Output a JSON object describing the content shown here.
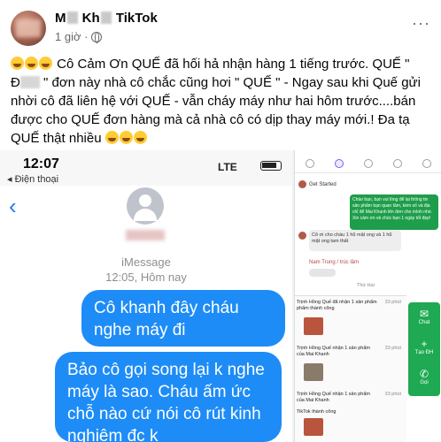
{
  "post": {
    "author_visible": "M",
    "author_visible_2": "Kh",
    "author_suffix": "TikTok",
    "time": "1 giờ ·",
    "more": "···",
    "text_line1": "Cô Cảm Ơn QUẾ đã hối hả nhận hàng 1 tiếng trước. QUẾ \"",
    "text_line2a": "Đ",
    "text_line2b": "\" đơn này nhà cô chắc cũng hơi \" QUẾ \" - Ngay sau khi Quế gửi",
    "text_line3": "nhời cô đã liên hệ với QUẾ - vẫn cháy máy như hai hôm trước....bán",
    "text_line4": "được cho QUẾ đơn hàng mà cả nhà cô có dịp thay máy mới.! Đa tạ",
    "text_line5": "QUẾ thật nhiều"
  },
  "phone": {
    "clock": "12:07",
    "carrier": "◂ Điện thoại",
    "signal": "LTE",
    "imessage_label": "iMessage",
    "imessage_time": "12:05, Hôm nay",
    "bubble1": "Cô khanh đây cháu nghe máy đi",
    "bubble2": "Bảo cô gọi song lại k nghe máy là sao. Cháu ấm ức chỗ nào cứ nói cô rút kinh nghiệm đc k"
  },
  "panel": {
    "get_started": "Get Started",
    "green_msg": "Chào bạn, bạn vui lòng để lại thông tin sản phẩm bạn quan tâm, kèm số và địa chỉ để Mai Khanh lên đơn cho mình nhé. Xin cảm ơn và chúc bạn 1 ngày tốt đẹp!",
    "gray_msg": "Cô ơi cho cháu 1 hũ mật ong và 1 hũ mật ong tam thất",
    "name_line": "Nam Trung / trúc lâm",
    "day_label": "Thứ Hai",
    "feed": [
      {
        "text": "Trịnh Hồng Quế đã nhận 1 sản phẩm",
        "sub": "phẩm thành công",
        "time": "33 phút"
      },
      {
        "text": "Trịnh Hồng Quế nhận 1 sản phẩm",
        "sub": "của Mai Khanh",
        "time": "33 phút"
      },
      {
        "text": "Trịnh Hồng Quế nhận 1 sản phẩm",
        "sub": "của Mai Khanh",
        "time": "33 phút"
      },
      {
        "text": "TikTok thành công",
        "sub": "",
        "time": ""
      }
    ],
    "rail": [
      {
        "icon": "✉",
        "label": "Chat"
      },
      {
        "icon": "+",
        "label": "Tạo ĐH"
      },
      {
        "icon": "✆",
        "label": "Gọi"
      }
    ]
  }
}
